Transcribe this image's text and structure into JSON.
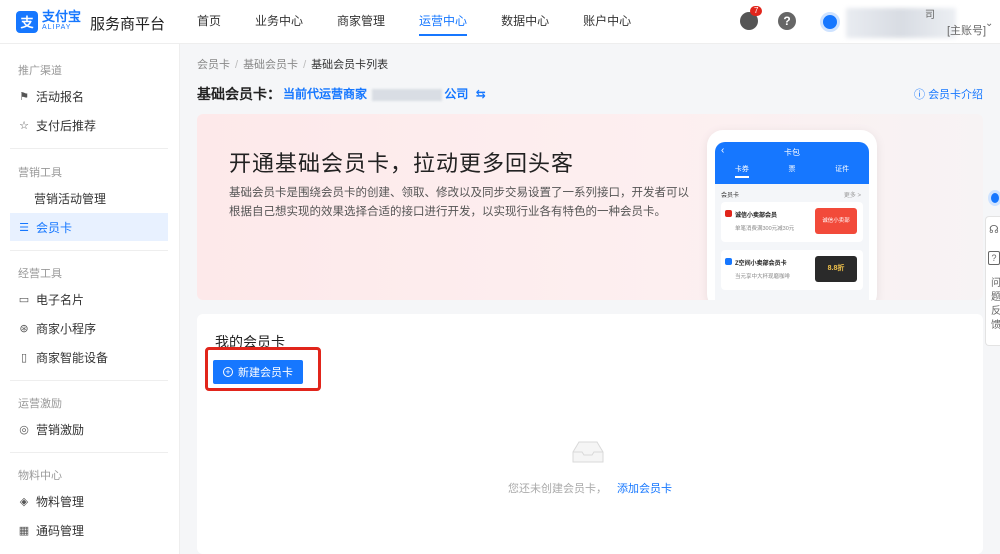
{
  "header": {
    "logo_mark": "支",
    "logo_cn": "支付宝",
    "logo_en": "ALIPAY",
    "platform": "服务商平台",
    "nav": [
      "首页",
      "业务中心",
      "商家管理",
      "运营中心",
      "数据中心",
      "账户中心"
    ],
    "active_nav_index": 3,
    "notification_count": "7",
    "help_glyph": "?",
    "account_top": "司",
    "account_role": "[主账号]"
  },
  "sidebar": {
    "groups": [
      {
        "label": "推广渠道",
        "items": [
          {
            "label": "活动报名",
            "icon": "flag-icon"
          },
          {
            "label": "支付后推荐",
            "icon": "star-icon"
          }
        ]
      },
      {
        "label": "营销工具",
        "items": [
          {
            "label": "营销活动管理",
            "icon": ""
          },
          {
            "label": "会员卡",
            "icon": "card-list-icon",
            "active": true
          }
        ]
      },
      {
        "label": "经营工具",
        "items": [
          {
            "label": "电子名片",
            "icon": "id-card-icon"
          },
          {
            "label": "商家小程序",
            "icon": "miniapp-icon"
          },
          {
            "label": "商家智能设备",
            "icon": "device-icon"
          }
        ]
      },
      {
        "label": "运营激励",
        "items": [
          {
            "label": "营销激励",
            "icon": "medal-icon"
          }
        ]
      },
      {
        "label": "物料中心",
        "items": [
          {
            "label": "物料管理",
            "icon": "layers-icon"
          },
          {
            "label": "通码管理",
            "icon": "qr-grid-icon"
          }
        ]
      }
    ]
  },
  "breadcrumb": [
    "会员卡",
    "基础会员卡",
    "基础会员卡列表"
  ],
  "page": {
    "title": "基础会员卡：",
    "merchant_prefix": "当前代运营商家",
    "merchant_suffix": "公司",
    "switch_glyph": "⇆",
    "intro_link": "会员卡介绍"
  },
  "banner": {
    "title": "开通基础会员卡，拉动更多回头客",
    "desc": "基础会员卡是围绕会员卡的创建、领取、修改以及同步交易设置了一系列接口，开发者可以根据自己想实现的效果选择合适的接口进行开发，以实现行业各有特色的一种会员卡。",
    "phone": {
      "title": "卡包",
      "tabs": [
        "卡券",
        "票",
        "证件"
      ],
      "section": "会员卡",
      "more": "更多 >",
      "card1_title": "诚信小卖部会员",
      "card1_sub": "单笔消费满300元减30元",
      "card1_badge": "诚信小卖部",
      "card2_title": "Z空间小卖部会员卡",
      "card2_sub": "当元享中大杯现磨咖啡",
      "card2_badge": "8.8折"
    }
  },
  "mycards": {
    "title": "我的会员卡",
    "create_button": "新建会员卡",
    "empty_text": "您还未创建会员卡，",
    "empty_link": "添加会员卡"
  },
  "float": {
    "text": "问题反馈"
  }
}
